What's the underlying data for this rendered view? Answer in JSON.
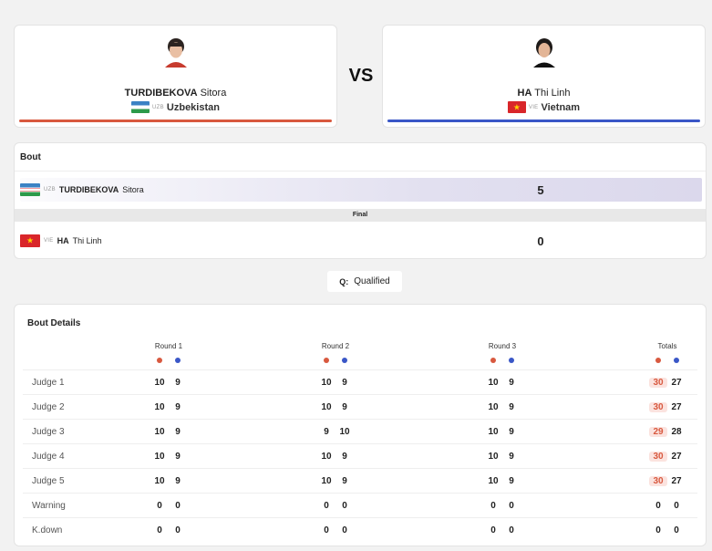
{
  "red": {
    "surname": "TURDIBEKOVA",
    "given": "Sitora",
    "code": "UZB",
    "country": "Uzbekistan",
    "color": "#d8593f"
  },
  "blue": {
    "surname": "HA",
    "given": "Thi Linh",
    "code": "VIE",
    "country": "Vietnam",
    "color": "#3a57c7"
  },
  "vs": "VS",
  "bout": {
    "title": "Bout",
    "red_score": "5",
    "blue_score": "0",
    "result": "Final"
  },
  "legend": {
    "key": "Q:",
    "label": "Qualified"
  },
  "details": {
    "title": "Bout Details",
    "columns": [
      "Round 1",
      "Round 2",
      "Round 3",
      "Totals"
    ],
    "rows": [
      {
        "label": "Judge 1",
        "r1": [
          "10",
          "9"
        ],
        "r2": [
          "10",
          "9"
        ],
        "r3": [
          "10",
          "9"
        ],
        "tot": [
          "30",
          "27"
        ]
      },
      {
        "label": "Judge 2",
        "r1": [
          "10",
          "9"
        ],
        "r2": [
          "10",
          "9"
        ],
        "r3": [
          "10",
          "9"
        ],
        "tot": [
          "30",
          "27"
        ]
      },
      {
        "label": "Judge 3",
        "r1": [
          "10",
          "9"
        ],
        "r2": [
          "9",
          "10"
        ],
        "r3": [
          "10",
          "9"
        ],
        "tot": [
          "29",
          "28"
        ]
      },
      {
        "label": "Judge 4",
        "r1": [
          "10",
          "9"
        ],
        "r2": [
          "10",
          "9"
        ],
        "r3": [
          "10",
          "9"
        ],
        "tot": [
          "30",
          "27"
        ]
      },
      {
        "label": "Judge 5",
        "r1": [
          "10",
          "9"
        ],
        "r2": [
          "10",
          "9"
        ],
        "r3": [
          "10",
          "9"
        ],
        "tot": [
          "30",
          "27"
        ]
      },
      {
        "label": "Warning",
        "r1": [
          "0",
          "0"
        ],
        "r2": [
          "0",
          "0"
        ],
        "r3": [
          "0",
          "0"
        ],
        "tot": [
          "0",
          "0"
        ]
      },
      {
        "label": "K.down",
        "r1": [
          "0",
          "0"
        ],
        "r2": [
          "0",
          "0"
        ],
        "r3": [
          "0",
          "0"
        ],
        "tot": [
          "0",
          "0"
        ]
      }
    ]
  }
}
